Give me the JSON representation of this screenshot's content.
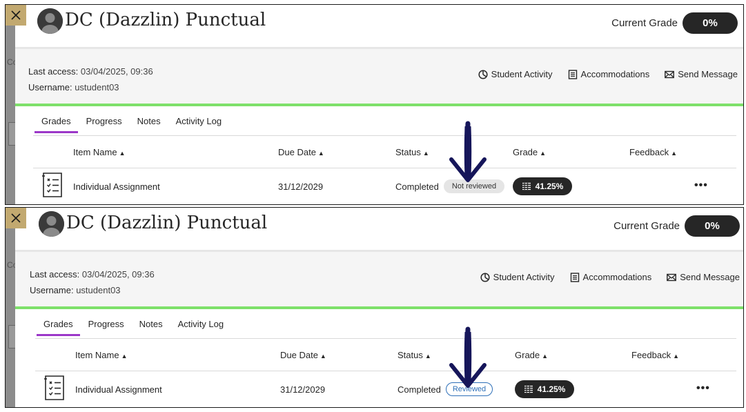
{
  "panels": [
    {
      "close_label": "Close",
      "student_name": "DC (Dazzlin) Punctual",
      "current_grade_label": "Current Grade",
      "current_grade_value": "0%",
      "last_access_label": "Last access:",
      "last_access_value": "03/04/2025, 09:36",
      "username_label": "Username:",
      "username_value": "ustudent03",
      "actions": [
        "Student Activity",
        "Accommodations",
        "Send Message"
      ],
      "tabs": [
        "Grades",
        "Progress",
        "Notes",
        "Activity Log"
      ],
      "active_tab": "Grades",
      "columns": [
        "Item Name",
        "Due Date",
        "Status",
        "Grade",
        "Feedback"
      ],
      "row": {
        "item_name": "Individual Assignment",
        "due_date": "31/12/2029",
        "status": "Completed",
        "review_badge": "Not reviewed",
        "grade": "41.25%",
        "more": "•••"
      },
      "backdrop_text": "Co"
    },
    {
      "close_label": "Close",
      "student_name": "DC (Dazzlin) Punctual",
      "current_grade_label": "Current Grade",
      "current_grade_value": "0%",
      "last_access_label": "Last access:",
      "last_access_value": "03/04/2025, 09:36",
      "username_label": "Username:",
      "username_value": "ustudent03",
      "actions": [
        "Student Activity",
        "Accommodations",
        "Send Message"
      ],
      "tabs": [
        "Grades",
        "Progress",
        "Notes",
        "Activity Log"
      ],
      "active_tab": "Grades",
      "columns": [
        "Item Name",
        "Due Date",
        "Status",
        "Grade",
        "Feedback"
      ],
      "row": {
        "item_name": "Individual Assignment",
        "due_date": "31/12/2029",
        "status": "Completed",
        "review_badge": "Reviewed",
        "grade": "41.25%",
        "more": "•••"
      },
      "backdrop_text": "Co"
    }
  ],
  "colors": {
    "accent_green": "#7ee06a",
    "tab_underline": "#9b37c8",
    "dark_pill": "#262626",
    "reviewed_blue": "#2d6fb8",
    "annotation_arrow": "#16165a",
    "close_gold": "#c2a970"
  },
  "icons": {
    "close": "close-icon",
    "avatar": "avatar-icon",
    "student_activity": "activity-chart-icon",
    "accommodations": "document-list-icon",
    "send_message": "envelope-icon",
    "item": "checklist-icon",
    "grade": "gradebook-icon",
    "annotation": "down-arrow-icon"
  }
}
